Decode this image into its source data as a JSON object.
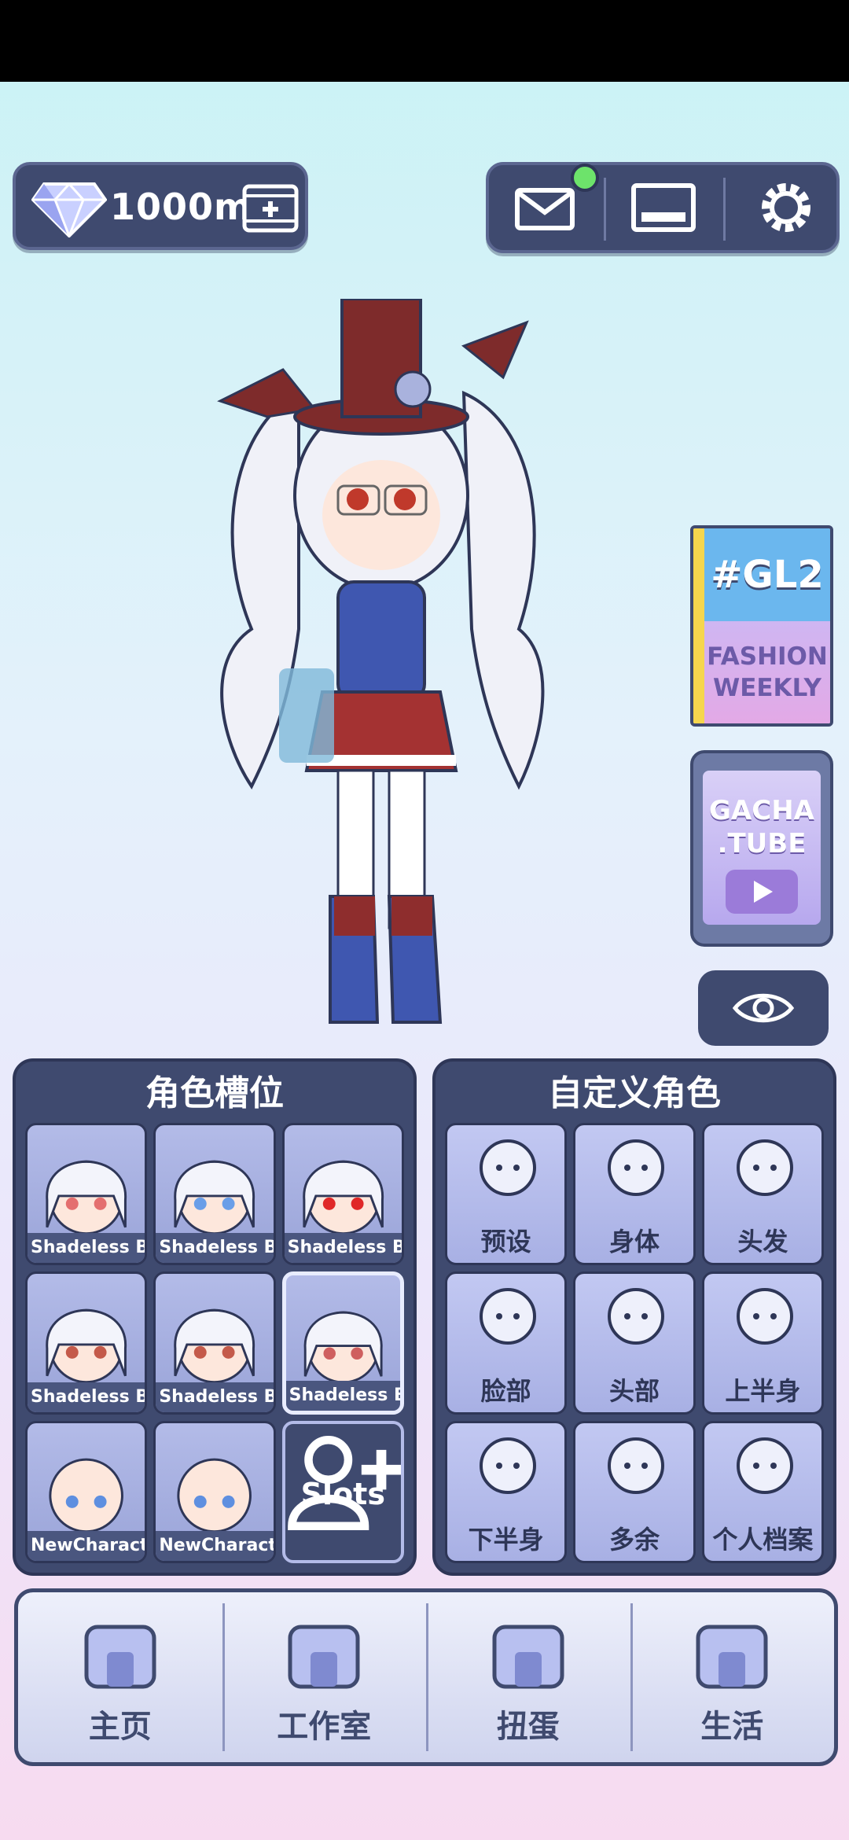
{
  "currency": {
    "value": "1000m",
    "icon": "diamond-icon",
    "add_icon": "video-add-icon"
  },
  "top_icons": [
    "mail-icon",
    "gallery-icon",
    "settings-icon"
  ],
  "side": {
    "gl2_title": "#GL2",
    "gl2_line1": "FASHION",
    "gl2_line2": "WEEKLY",
    "gtube_line1": "GACHA",
    "gtube_line2": ".TUBE"
  },
  "slots_panel": {
    "title": "角色槽位",
    "slots": [
      {
        "name": "Shadeless Bas",
        "eye": "#e46f6f"
      },
      {
        "name": "Shadeless Bas",
        "eye": "#6a9ee8"
      },
      {
        "name": "Shadeless Bas",
        "eye": "#e02828"
      },
      {
        "name": "Shadeless Bas",
        "eye": "#c45a4a"
      },
      {
        "name": "Shadeless Bas",
        "eye": "#c45a4a"
      },
      {
        "name": "Shadeless Bas",
        "eye": "#cf5f5f"
      },
      {
        "name": "NewCharacter",
        "eye": "#5e8fe0"
      },
      {
        "name": "NewCharacter",
        "eye": "#5e8fe0"
      }
    ],
    "add_label": "Slots"
  },
  "custom_panel": {
    "title": "自定义角色",
    "items": [
      {
        "label": "预设",
        "icon": "preset-icon"
      },
      {
        "label": "身体",
        "icon": "body-icon"
      },
      {
        "label": "头发",
        "icon": "hair-icon"
      },
      {
        "label": "脸部",
        "icon": "face-icon"
      },
      {
        "label": "头部",
        "icon": "head-accessory-icon"
      },
      {
        "label": "上半身",
        "icon": "upper-body-icon"
      },
      {
        "label": "下半身",
        "icon": "lower-body-icon"
      },
      {
        "label": "多余",
        "icon": "extra-icon"
      },
      {
        "label": "个人档案",
        "icon": "profile-icon"
      }
    ]
  },
  "nav": [
    {
      "label": "主页",
      "icon": "home-icon"
    },
    {
      "label": "工作室",
      "icon": "studio-icon"
    },
    {
      "label": "扭蛋",
      "icon": "gacha-icon"
    },
    {
      "label": "生活",
      "icon": "life-icon"
    }
  ],
  "colors": {
    "panel": "#3f4a6f",
    "accent": "#b3bbe8",
    "notif": "#6de36b"
  }
}
